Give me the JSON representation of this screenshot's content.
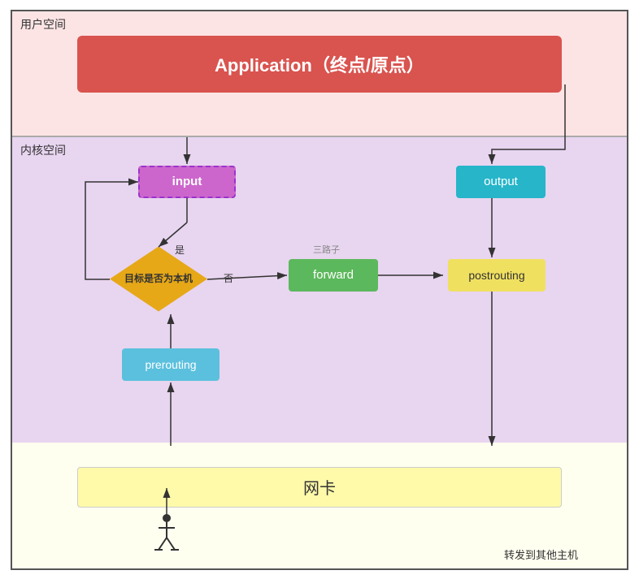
{
  "userSpace": {
    "label": "用户空间",
    "appBox": "Application（终点/原点）"
  },
  "kernelSpace": {
    "label": "内核空间",
    "inputBox": "input",
    "outputBox": "output",
    "diamondText": "目标是否为本机",
    "yesLabel": "是",
    "noLabel": "否",
    "forwardBox": "forward",
    "forwardTopLabel": "三路子",
    "postroutingBox": "postrouting",
    "preroutingBox": "prerouting"
  },
  "netcardSpace": {
    "netcardBox": "网卡",
    "forwardLabel": "转发到其他主机"
  }
}
